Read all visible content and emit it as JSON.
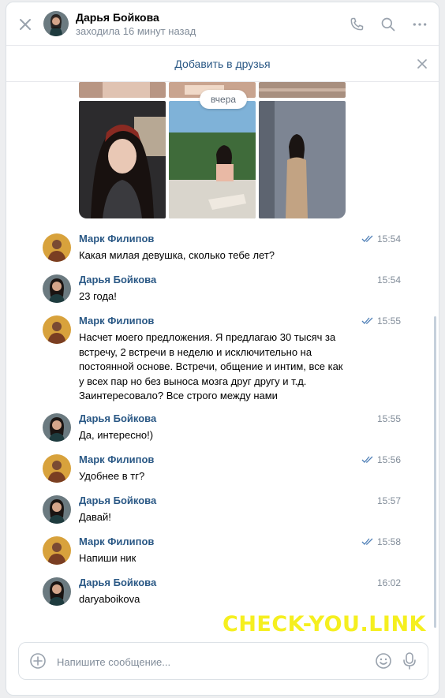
{
  "header": {
    "name": "Дарья Бойкова",
    "status": "заходила 16 минут назад"
  },
  "friend_bar": {
    "label": "Добавить в друзья"
  },
  "date_divider": "вчера",
  "messages": [
    {
      "author": "Марк Филипов",
      "time": "15:54",
      "read": true,
      "text": "Какая милая девушка, сколько тебе лет?"
    },
    {
      "author": "Дарья Бойкова",
      "time": "15:54",
      "read": false,
      "text": "23 года!"
    },
    {
      "author": "Марк Филипов",
      "time": "15:55",
      "read": true,
      "text": "Насчет моего предложения. Я предлагаю 30 тысяч за встречу, 2 встречи в неделю и исключительно на постоянной основе. Встречи, общение и интим, все как у всех пар но без выноса мозга друг другу и т.д. Заинтересовало? Все строго между нами"
    },
    {
      "author": "Дарья Бойкова",
      "time": "15:55",
      "read": false,
      "text": "Да, интересно!)"
    },
    {
      "author": "Марк Филипов",
      "time": "15:56",
      "read": true,
      "text": "Удобнее в тг?"
    },
    {
      "author": "Дарья Бойкова",
      "time": "15:57",
      "read": false,
      "text": "Давай!"
    },
    {
      "author": "Марк Филипов",
      "time": "15:58",
      "read": true,
      "text": "Напиши ник"
    },
    {
      "author": "Дарья Бойкова",
      "time": "16:02",
      "read": false,
      "text": "daryaboikova"
    }
  ],
  "composer": {
    "placeholder": "Напишите сообщение..."
  },
  "watermark": "CHECK-YOU.LINK",
  "colors": {
    "accent": "#2a5885",
    "link": "#2a5885",
    "muted": "#818c99",
    "read_check": "#5181b8"
  }
}
